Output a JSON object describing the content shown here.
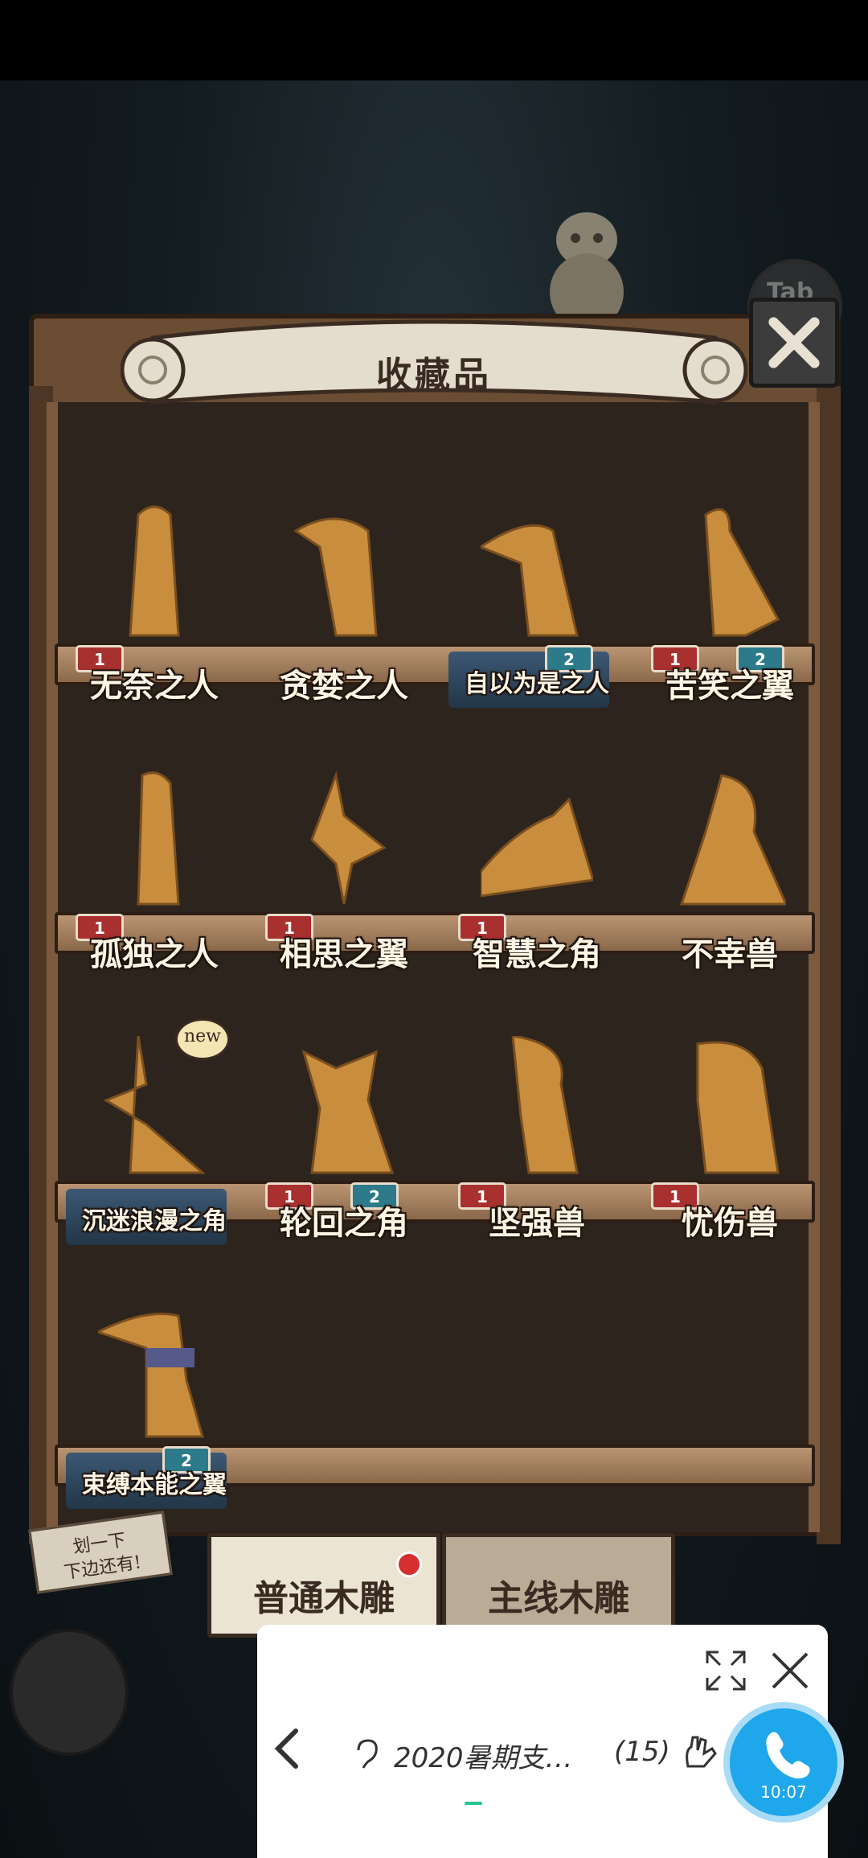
{
  "window": {
    "title": "收藏品"
  },
  "colors": {
    "wood": "#6b4d34",
    "shelf": "#b99572",
    "highlight_plate": "#3d5874",
    "badge_red": "#a8302f",
    "badge_teal": "#2c7a8a",
    "call_blue": "#1ea7ea"
  },
  "items": [
    {
      "label": "无奈之人",
      "badges": [
        "1"
      ],
      "highlight": false
    },
    {
      "label": "贪婪之人",
      "badges": [],
      "highlight": false
    },
    {
      "label": "自以为是之人",
      "badges": [
        "2"
      ],
      "highlight": true
    },
    {
      "label": "苦笑之翼",
      "badges": [
        "1",
        "2"
      ],
      "highlight": false
    },
    {
      "label": "孤独之人",
      "badges": [
        "1"
      ],
      "highlight": false
    },
    {
      "label": "相思之翼",
      "badges": [
        "1"
      ],
      "highlight": false
    },
    {
      "label": "智慧之角",
      "badges": [
        "1"
      ],
      "highlight": false
    },
    {
      "label": "不幸兽",
      "badges": [],
      "highlight": false
    },
    {
      "label": "沉迷浪漫之角",
      "badges": [],
      "highlight": true,
      "new": "new"
    },
    {
      "label": "轮回之角",
      "badges": [
        "1",
        "2"
      ],
      "highlight": false
    },
    {
      "label": "坚强兽",
      "badges": [
        "1"
      ],
      "highlight": false
    },
    {
      "label": "忧伤兽",
      "badges": [
        "1"
      ],
      "highlight": false
    },
    {
      "label": "束缚本能之翼",
      "badges": [
        "2"
      ],
      "highlight": true
    }
  ],
  "new_badge": "new",
  "hint": {
    "line1": "划一下",
    "line2": "下边还有!"
  },
  "tabs": {
    "normal": "普通木雕",
    "main": "主线木雕"
  },
  "tab_hint": "Tab",
  "call_widget": {
    "title": "2020暑期支…",
    "count": "(15)",
    "time": "10:07"
  }
}
